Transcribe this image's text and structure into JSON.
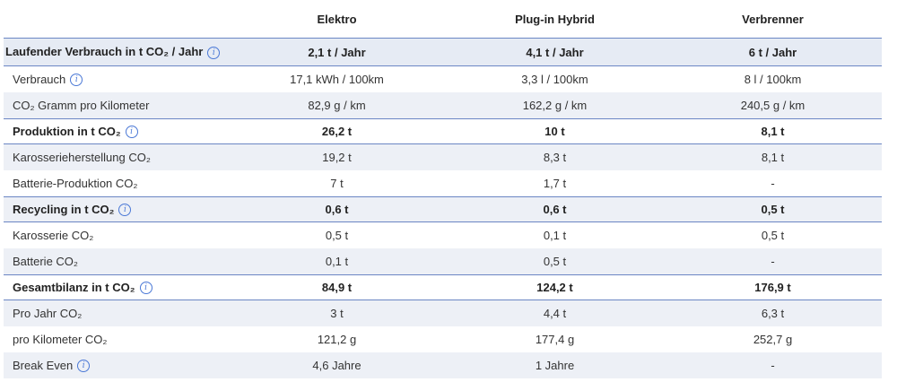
{
  "header": {
    "col1": "Elektro",
    "col2": "Plug-in Hybrid",
    "col3": "Verbrenner"
  },
  "rows": [
    {
      "label": "Laufender Verbrauch in t CO₂ / Jahr",
      "info": true,
      "v1": "2,1 t / Jahr",
      "v2": "4,1 t / Jahr",
      "v3": "6 t / Jahr"
    },
    {
      "label": "Verbrauch",
      "info": true,
      "v1": "17,1 kWh / 100km",
      "v2": "3,3 l / 100km",
      "v3": "8 l / 100km"
    },
    {
      "label": "CO₂ Gramm pro Kilometer",
      "v1": "82,9 g / km",
      "v2": "162,2 g / km",
      "v3": "240,5 g / km"
    },
    {
      "label": "Produktion in t CO₂",
      "info": true,
      "v1": "26,2 t",
      "v2": "10 t",
      "v3": "8,1 t"
    },
    {
      "label": "Karosserieherstellung CO₂",
      "v1": "19,2 t",
      "v2": "8,3 t",
      "v3": "8,1 t"
    },
    {
      "label": "Batterie-Produktion CO₂",
      "v1": "7 t",
      "v2": "1,7 t",
      "v3": "-"
    },
    {
      "label": "Recycling in t CO₂",
      "info": true,
      "v1": "0,6 t",
      "v2": "0,6 t",
      "v3": "0,5 t"
    },
    {
      "label": "Karosserie CO₂",
      "v1": "0,5 t",
      "v2": "0,1 t",
      "v3": "0,5 t"
    },
    {
      "label": "Batterie CO₂",
      "v1": "0,1 t",
      "v2": "0,5 t",
      "v3": "-"
    },
    {
      "label": "Gesamtbilanz in t CO₂",
      "info": true,
      "v1": "84,9 t",
      "v2": "124,2 t",
      "v3": "176,9 t"
    },
    {
      "label": "Pro Jahr CO₂",
      "v1": "3 t",
      "v2": "4,4 t",
      "v3": "6,3 t"
    },
    {
      "label": "pro Kilometer CO₂",
      "v1": "121,2 g",
      "v2": "177,4 g",
      "v3": "252,7 g"
    },
    {
      "label": "Break Even",
      "info": true,
      "v1": "4,6 Jahre",
      "v2": "1 Jahre",
      "v3": "-"
    }
  ],
  "info_icon": "info-circle-icon",
  "colors": {
    "accent_line": "#6b86c4",
    "alt_row": "#edf0f6",
    "info_icon": "#4a78d6"
  }
}
